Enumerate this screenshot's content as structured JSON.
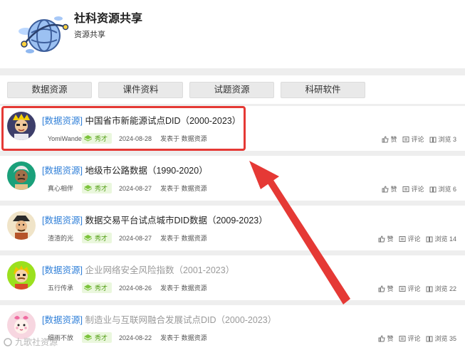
{
  "site": {
    "title": "社科资源共享",
    "subtitle": "资源共享"
  },
  "categories": [
    "数据资源",
    "课件资料",
    "试题资源",
    "科研软件"
  ],
  "posts": [
    {
      "tag": "[数据资源]",
      "title": "中国省市新能源试点DID（2000-2023）",
      "author": "YomiWander",
      "badge": "秀才",
      "date": "2024-08-28",
      "posted_in": "发表于 数据资源",
      "like": "赞",
      "comment": "评论",
      "views": "浏览 3",
      "faded": false
    },
    {
      "tag": "[数据资源]",
      "title": "地级市公路数据（1990-2020）",
      "author": "真心相伴",
      "badge": "秀才",
      "date": "2024-08-27",
      "posted_in": "发表于 数据资源",
      "like": "赞",
      "comment": "评论",
      "views": "浏览 6",
      "faded": false
    },
    {
      "tag": "[数据资源]",
      "title": "数据交易平台试点城市DID数据（2009-2023）",
      "author": "渣渣的光",
      "badge": "秀才",
      "date": "2024-08-27",
      "posted_in": "发表于 数据资源",
      "like": "赞",
      "comment": "评论",
      "views": "浏览 14",
      "faded": false
    },
    {
      "tag": "[数据资源]",
      "title": "企业网络安全风险指数（2001-2023）",
      "author": "五行传承",
      "badge": "秀才",
      "date": "2024-08-26",
      "posted_in": "发表于 数据资源",
      "like": "赞",
      "comment": "评论",
      "views": "浏览 22",
      "faded": true
    },
    {
      "tag": "[数据资源]",
      "title": "制造业与互联网融合发展试点DID（2000-2023）",
      "author": "细雨不放",
      "badge": "秀才",
      "date": "2024-08-22",
      "posted_in": "发表于 数据资源",
      "like": "赞",
      "comment": "评论",
      "views": "浏览 35",
      "faded": true
    }
  ],
  "watermark": "九歌社资源",
  "colors": {
    "tag": "#2f7fd8",
    "highlight": "#e53935",
    "badge_bg": "#eaf7dd",
    "badge_text": "#5aa21e"
  }
}
